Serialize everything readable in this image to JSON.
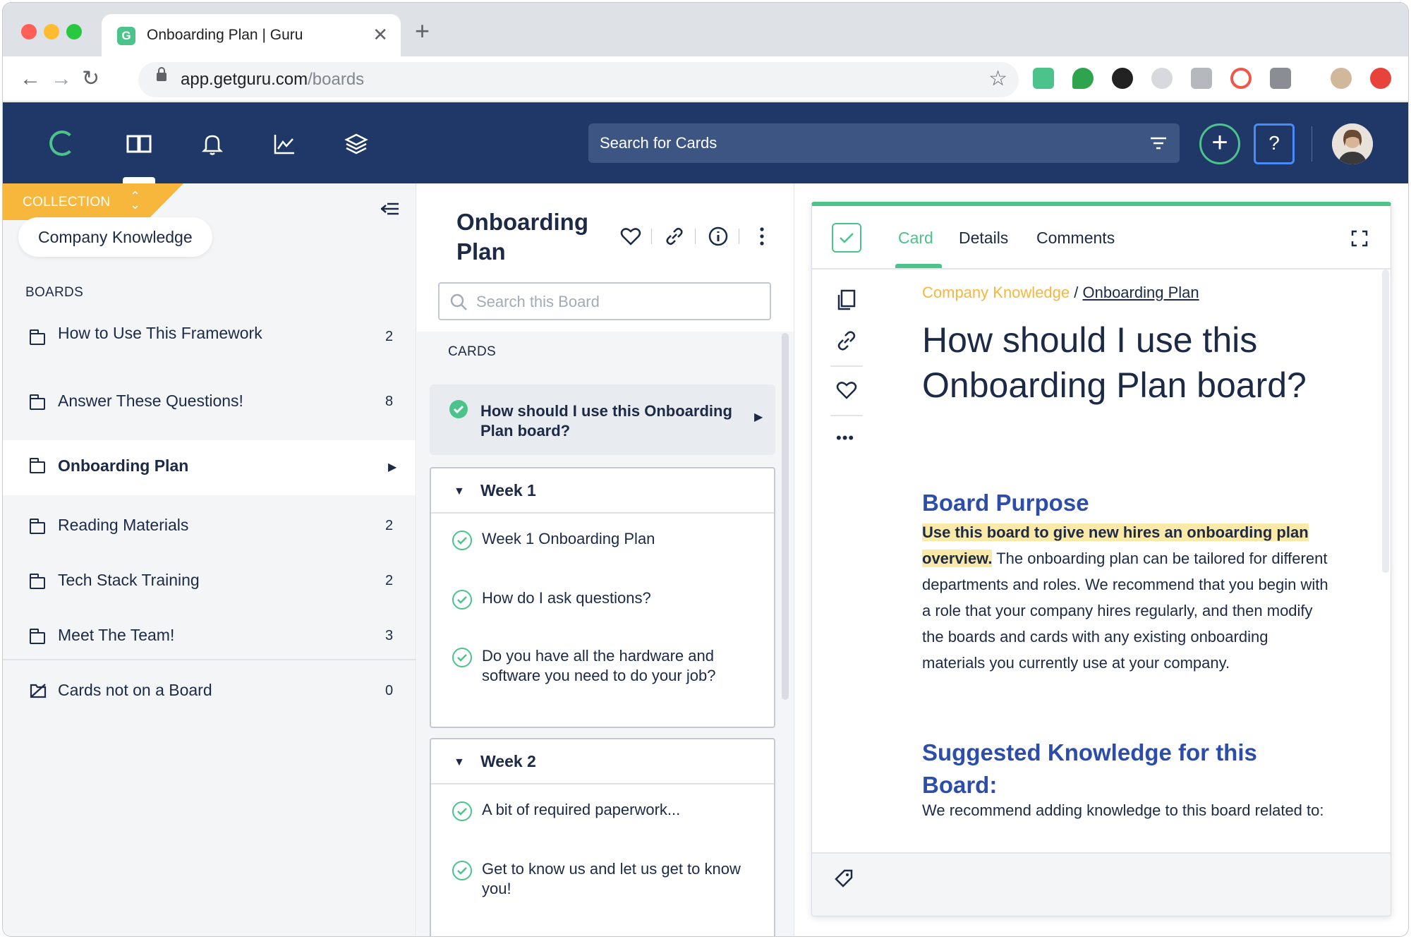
{
  "browser": {
    "tab_title": "Onboarding Plan | Guru",
    "tab_close": "✕",
    "new_tab": "+",
    "url_host": "app.getguru.com",
    "url_path": "/boards",
    "back": "←",
    "forward": "→",
    "reload": "↻",
    "star": "☆"
  },
  "app_header": {
    "search_placeholder": "Search for Cards",
    "add_label": "+",
    "help_label": "?",
    "nav_icons": [
      "guru-logo-icon",
      "book-icon",
      "bell-icon",
      "chart-icon",
      "layers-icon"
    ]
  },
  "sidebar": {
    "collection_label": "COLLECTION",
    "collection_chevron": "⌃⌄",
    "collection_name": "Company Knowledge",
    "boards_header": "BOARDS",
    "boards": [
      {
        "label": "How to Use This Framework",
        "count": "2"
      },
      {
        "label": "Answer These Questions!",
        "count": "8"
      },
      {
        "label": "Onboarding Plan",
        "count": "",
        "active": true
      },
      {
        "label": "Reading Materials",
        "count": "2"
      },
      {
        "label": "Tech Stack Training",
        "count": "2"
      },
      {
        "label": "Meet The Team!",
        "count": "3"
      }
    ],
    "unboarded": {
      "label": "Cards not on a Board",
      "count": "0"
    }
  },
  "board_panel": {
    "title": "Onboarding Plan",
    "search_placeholder": "Search this Board",
    "cards_header": "CARDS",
    "featured_card": "How should I use this Onboarding Plan board?",
    "groups": [
      {
        "title": "Week 1",
        "items": [
          "Week 1 Onboarding Plan",
          "How do I ask questions?",
          "Do you have all the hardware and software you need to do your job?"
        ]
      },
      {
        "title": "Week 2",
        "items": [
          "A bit of required paperwork...",
          "Get to know us and let us get to know you!"
        ]
      }
    ]
  },
  "card_panel": {
    "tabs": [
      "Card",
      "Details",
      "Comments"
    ],
    "breadcrumb_collection": "Company Knowledge",
    "breadcrumb_sep": " / ",
    "breadcrumb_board": "Onboarding Plan",
    "title": "How should I use this Onboarding Plan board?",
    "section1_heading": "Board Purpose",
    "section1_highlight": "Use this board to give new hires an onboarding plan overview.",
    "section1_body": " The onboarding plan can be tailored for different departments and roles. We recommend that you begin with a role that your company hires regularly, and then modify the boards and cards with any existing onboarding materials you currently use at your company.",
    "section2_heading": "Suggested Knowledge for this Board:",
    "section2_body": "We recommend adding knowledge to this board related to:",
    "more_label": "•••"
  },
  "colors": {
    "header_bg": "#1f3868",
    "brand_green": "#4cc38a",
    "collection_orange": "#f6b73c",
    "heading_blue": "#2d4dab",
    "text_navy": "#1c2a46"
  }
}
